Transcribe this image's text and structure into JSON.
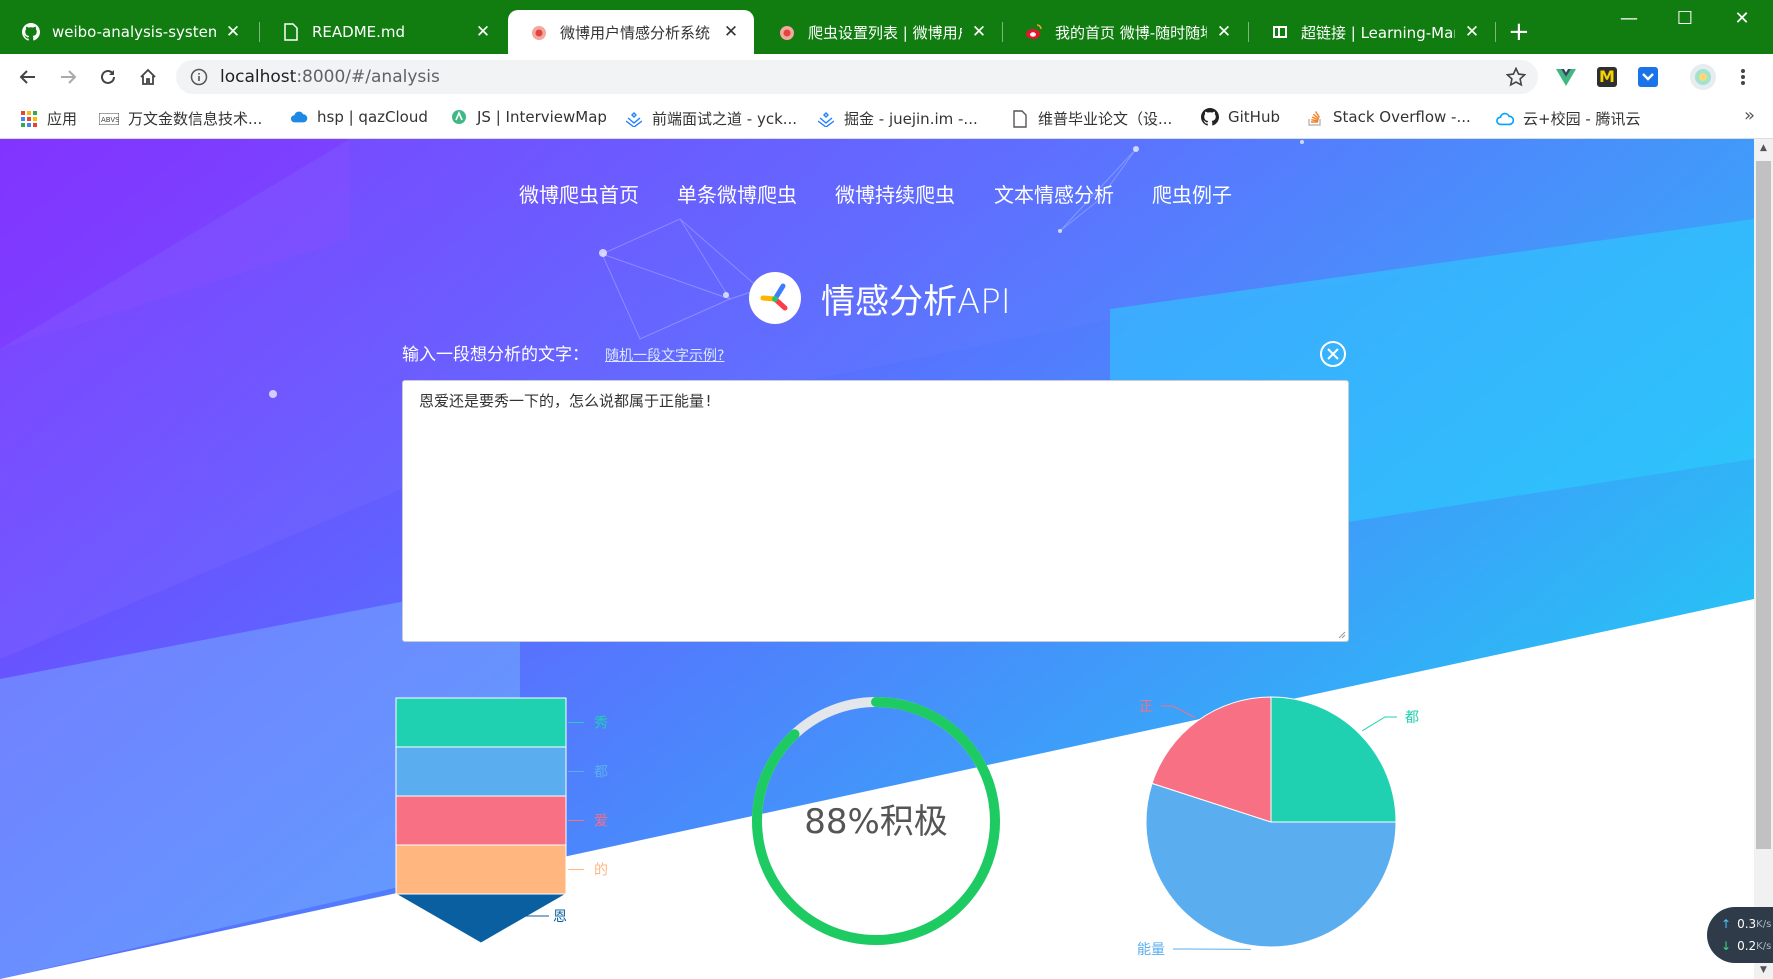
{
  "browser": {
    "tabs": [
      {
        "title": "weibo-analysis-system/",
        "icon": "github-icon"
      },
      {
        "title": "README.md",
        "icon": "file-icon"
      },
      {
        "title": "微博用户情感分析系统",
        "icon": "weibo-spider-icon",
        "active": true
      },
      {
        "title": "爬虫设置列表 | 微博用户",
        "icon": "weibo-spider-icon"
      },
      {
        "title": "我的首页 微博-随时随地",
        "icon": "weibo-icon"
      },
      {
        "title": "超链接 | Learning-Mark",
        "icon": "book-icon"
      }
    ],
    "close_glyph": "✕",
    "new_tab_glyph": "+",
    "window_controls": {
      "minimize": "—",
      "maximize": "☐",
      "close": "✕"
    },
    "url_host": "localhost",
    "url_rest": ":8000/#/analysis",
    "bookmarks": [
      {
        "label": "应用",
        "icon": "apps-grid-icon"
      },
      {
        "label": "万文金数信息技术...",
        "icon": "wanwen-icon"
      },
      {
        "label": "hsp | qazCloud",
        "icon": "cloud-icon"
      },
      {
        "label": "JS | InterviewMap",
        "icon": "interviewmap-icon"
      },
      {
        "label": "前端面试之道 - yck...",
        "icon": "juejin-icon"
      },
      {
        "label": "掘金 - juejin.im -...",
        "icon": "juejin-icon"
      },
      {
        "label": "维普毕业论文（设...",
        "icon": "file-icon"
      },
      {
        "label": "GitHub",
        "icon": "github-icon"
      },
      {
        "label": "Stack Overflow -...",
        "icon": "stackoverflow-icon"
      },
      {
        "label": "云+校园 - 腾讯云",
        "icon": "tencent-cloud-icon"
      }
    ],
    "bookmarks_more": "»"
  },
  "page": {
    "nav": [
      "微博爬虫首页",
      "单条微博爬虫",
      "微博持续爬虫",
      "文本情感分析",
      "爬虫例子"
    ],
    "title": "情感分析API",
    "prompt_label": "输入一段想分析的文字：",
    "random_example_link": "随机一段文字示例?",
    "input_text": "恩爱还是要秀一下的，怎么说都属于正能量!",
    "gauge_text": "88%积极"
  },
  "net_speed": {
    "up": "0.3",
    "down": "0.2",
    "unit": "K/s"
  },
  "colors": {
    "green": "#1ecb62",
    "teal": "#1fd1b0",
    "blue": "#5aaef0",
    "pink": "#f87084",
    "orange": "#ffb67f",
    "navy": "#0a5fa0",
    "tabstrip": "#117d11"
  },
  "chart_data": [
    {
      "type": "funnel",
      "categories": [
        "秀",
        "都",
        "爱",
        "的",
        "恩"
      ],
      "colors": [
        "#1fd1b0",
        "#5aaef0",
        "#f87084",
        "#ffb67f",
        "#0a5fa0"
      ]
    },
    {
      "type": "gauge",
      "value": 88,
      "label": "88%积极"
    },
    {
      "type": "pie",
      "categories": [
        "都",
        "能量",
        "正"
      ],
      "values": [
        25,
        55,
        20
      ],
      "colors": [
        "#1fd1b0",
        "#5aaef0",
        "#f87084"
      ]
    }
  ]
}
